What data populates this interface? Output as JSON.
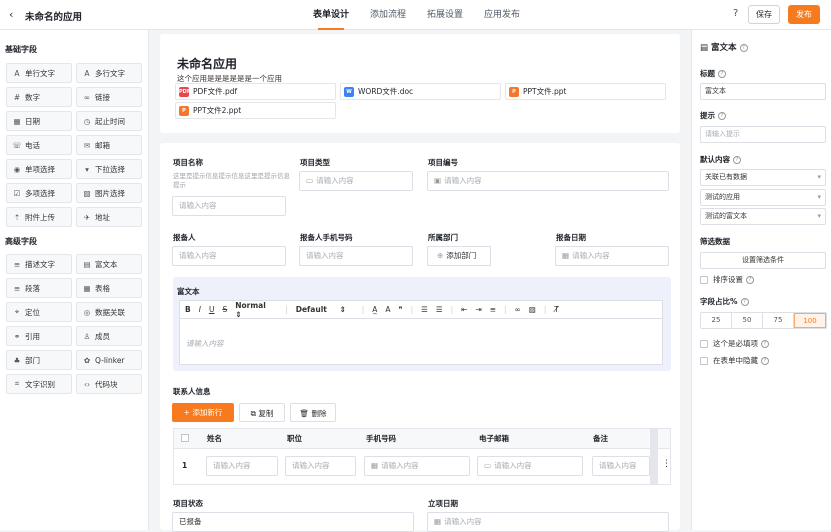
{
  "header": {
    "app_name": "未命名的应用",
    "tabs": [
      "表单设计",
      "添加流程",
      "拓展设置",
      "应用发布"
    ],
    "save": "保存",
    "publish": "发布",
    "help": "?"
  },
  "left": {
    "basic_title": "基础字段",
    "basic": [
      [
        "A",
        "单行文字"
      ],
      [
        "A",
        "多行文字"
      ],
      [
        "#",
        "数字"
      ],
      [
        "∞",
        "链接"
      ],
      [
        "▦",
        "日期"
      ],
      [
        "◷",
        "起止时间"
      ],
      [
        "☏",
        "电话"
      ],
      [
        "✉",
        "邮箱"
      ],
      [
        "◉",
        "单项选择"
      ],
      [
        "▾",
        "下拉选择"
      ],
      [
        "☑",
        "多项选择"
      ],
      [
        "▨",
        "图片选择"
      ],
      [
        "⇡",
        "附件上传"
      ],
      [
        "✈",
        "地址"
      ]
    ],
    "adv_title": "高级字段",
    "adv": [
      [
        "≡",
        "描述文字"
      ],
      [
        "▤",
        "富文本"
      ],
      [
        "≡",
        "段落"
      ],
      [
        "▦",
        "表格"
      ],
      [
        "⌖",
        "定位"
      ],
      [
        "◎",
        "数据关联"
      ],
      [
        "⚭",
        "引用"
      ],
      [
        "♙",
        "成员"
      ],
      [
        "♣",
        "部门"
      ],
      [
        "✿",
        "Q-linker"
      ],
      [
        "⌗",
        "文字识别"
      ],
      [
        "‹›",
        "代码块"
      ]
    ]
  },
  "form": {
    "title": "未命名应用",
    "desc": "这个应用是是是是是是一个应用",
    "files": [
      {
        "name": "PDF文件.pdf",
        "badge": "PDF",
        "color": "#e5484d"
      },
      {
        "name": "WORD文件.doc",
        "badge": "W",
        "color": "#3b82f6"
      },
      {
        "name": "PPT文件.ppt",
        "badge": "P",
        "color": "#f7762e"
      },
      {
        "name": "PPT文件2.ppt",
        "badge": "P",
        "color": "#f7762e"
      }
    ],
    "proj_name": "项目名称",
    "proj_hint": "这里是提示信息提示信息这里是提示信息提示",
    "proj_type": "项目类型",
    "proj_no": "项目编号",
    "ph": "请输入内容",
    "reporter": "报备人",
    "reporter_phone": "报备人手机号码",
    "dept": "所属部门",
    "add_dept": "添加部门",
    "report_date": "报备日期",
    "rich": "富文本",
    "rich_normal": "Normal",
    "rich_default": "Default",
    "rich_ph": "请输入内容",
    "contact": "联系人信息",
    "add_row": "添加新行",
    "copy": "复制",
    "delete": "删除",
    "cols": [
      "姓名",
      "职位",
      "手机号码",
      "电子邮箱",
      "备注"
    ],
    "row_no": "1",
    "status": "项目状态",
    "status_val": "已报备",
    "setup_date": "立项日期"
  },
  "props": {
    "head": "富文本",
    "title_lbl": "标题",
    "title_val": "富文本",
    "tip_lbl": "提示",
    "tip_ph": "请输入提示",
    "default_lbl": "默认内容",
    "d1": "关联已有数据",
    "d2": "测试的应用",
    "d3": "测试的富文本",
    "filter_lbl": "筛选数据",
    "filter_btn": "设置筛选条件",
    "sort": "排序设置",
    "width_lbl": "字段占比%",
    "widths": [
      "25",
      "50",
      "75",
      "100"
    ],
    "required": "这个是必填项",
    "hide": "在表单中隐藏"
  }
}
